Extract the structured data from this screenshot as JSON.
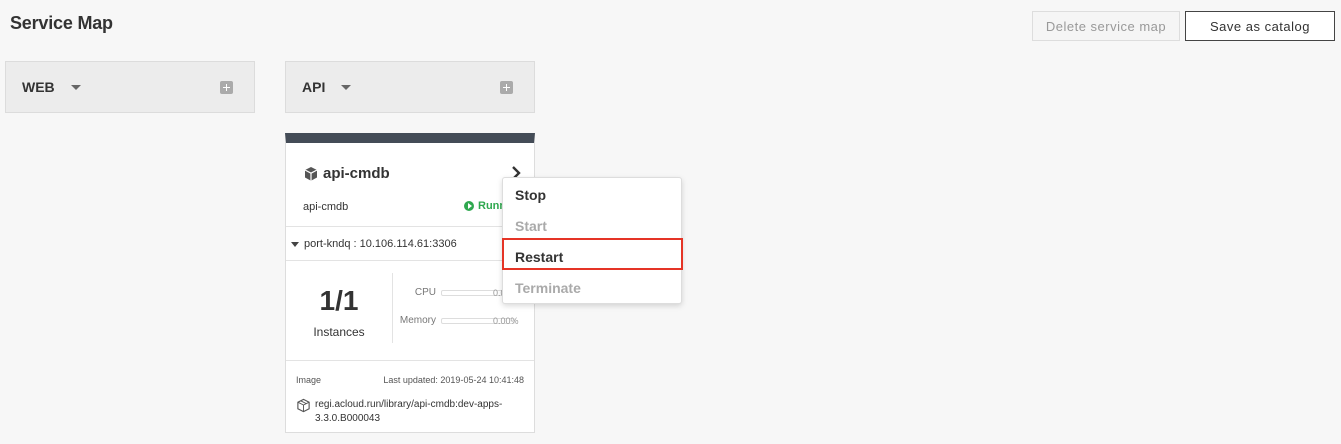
{
  "header": {
    "title": "Service Map",
    "delete_label": "Delete service map",
    "save_label": "Save as catalog"
  },
  "groups": [
    {
      "name": "WEB"
    },
    {
      "name": "API"
    }
  ],
  "card": {
    "title": "api-cmdb",
    "subtitle": "api-cmdb",
    "status": "Running",
    "port": "port-kndq : 10.106.114.61:3306",
    "instances_count": "1/1",
    "instances_label": "Instances",
    "cpu_label": "CPU",
    "cpu_value": "0.00%",
    "cpu_fraction": 0,
    "memory_label": "Memory",
    "memory_value": "0.00%",
    "memory_fraction": 0,
    "image_label": "Image",
    "last_updated": "Last updated: 2019-05-24 10:41:48",
    "image_path": "regi.acloud.run/library/api-cmdb:dev-apps-3.3.0.B000043"
  },
  "menu": {
    "items": [
      {
        "label": "Stop",
        "enabled": true
      },
      {
        "label": "Start",
        "enabled": false
      },
      {
        "label": "Restart",
        "enabled": true,
        "highlighted": true
      },
      {
        "label": "Terminate",
        "enabled": false
      }
    ]
  },
  "colors": {
    "card_header": "#444c57",
    "running": "#2fa84f",
    "highlight": "#e53426"
  }
}
